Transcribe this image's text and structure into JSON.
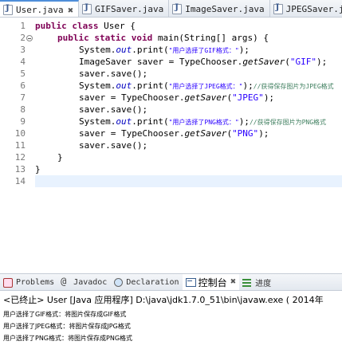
{
  "editor_tabs": [
    {
      "label": "User.java",
      "active": true,
      "closable": true,
      "icon": "java-file-icon"
    },
    {
      "label": "GIFSaver.java",
      "active": false,
      "icon": "java-file-icon"
    },
    {
      "label": "ImageSaver.java",
      "active": false,
      "icon": "java-file-icon"
    },
    {
      "label": "JPEGSaver.java",
      "active": false,
      "icon": "java-file-icon"
    }
  ],
  "editor": {
    "line_numbers": [
      "1",
      "2",
      "3",
      "4",
      "5",
      "6",
      "7",
      "8",
      "9",
      "10",
      "11",
      "12",
      "13",
      "14"
    ],
    "current_line": "14",
    "lines": {
      "l1": {
        "kw1": "public",
        "kw2": "class",
        "rest": "User {"
      },
      "l2": {
        "kw1": "public",
        "kw2": "static",
        "kw3": "void",
        "rest": "main(String[] args) {"
      },
      "l3": {
        "a": "System.",
        "field": "out",
        "b": ".print(",
        "str": "\"用户选择了GIF格式：\"",
        "c": ");"
      },
      "l4": {
        "a": "ImageSaver saver = TypeChooser.",
        "method": "getSaver",
        "b": "(",
        "str": "\"GIF\"",
        "c": ");"
      },
      "l5": {
        "a": "saver.save();"
      },
      "l6": {
        "a": "System.",
        "field": "out",
        "b": ".print(",
        "str": "\"用户选择了JPEG格式：\"",
        "c": ");",
        "comment": "//获得保存图片为JPEG格式"
      },
      "l7": {
        "a": "saver = TypeChooser.",
        "method": "getSaver",
        "b": "(",
        "str": "\"JPEG\"",
        "c": ");"
      },
      "l8": {
        "a": "saver.save();"
      },
      "l9": {
        "a": "System.",
        "field": "out",
        "b": ".print(",
        "str": "\"用户选择了PNG格式：\"",
        "c": ");",
        "comment": "//获得保存图片为PNG格式"
      },
      "l10": {
        "a": "saver = TypeChooser.",
        "method": "getSaver",
        "b": "(",
        "str": "\"PNG\"",
        "c": ");"
      },
      "l11": {
        "a": "saver.save();"
      },
      "l12": {
        "a": "}"
      },
      "l13": {
        "a": "}"
      },
      "l14": {
        "a": ""
      }
    }
  },
  "view_tabs": [
    {
      "label": "Problems",
      "icon": "problems-icon"
    },
    {
      "label": "Javadoc",
      "icon": "javadoc-icon"
    },
    {
      "label": "Declaration",
      "icon": "declaration-icon"
    },
    {
      "label": "控制台",
      "icon": "console-icon",
      "active": true,
      "closable": true
    },
    {
      "label": "进度",
      "icon": "progress-icon"
    }
  ],
  "console": {
    "header": "<已终止> User [Java 应用程序] D:\\java\\jdk1.7.0_51\\bin\\javaw.exe ( 2014年",
    "output": [
      "用户选择了GIF格式：将图片保存成GIF格式",
      "用户选择了JPEG格式：将图片保存成JPG格式",
      "用户选择了PNG格式：将图片保存成PNG格式"
    ]
  },
  "colors": {
    "keyword": "#7f0055",
    "string": "#2a00ff",
    "static_field": "#0000c0",
    "comment": "#3f7f5f",
    "current_line": "#e8f2fe",
    "active_tab_accent": "#4f8ed9"
  }
}
